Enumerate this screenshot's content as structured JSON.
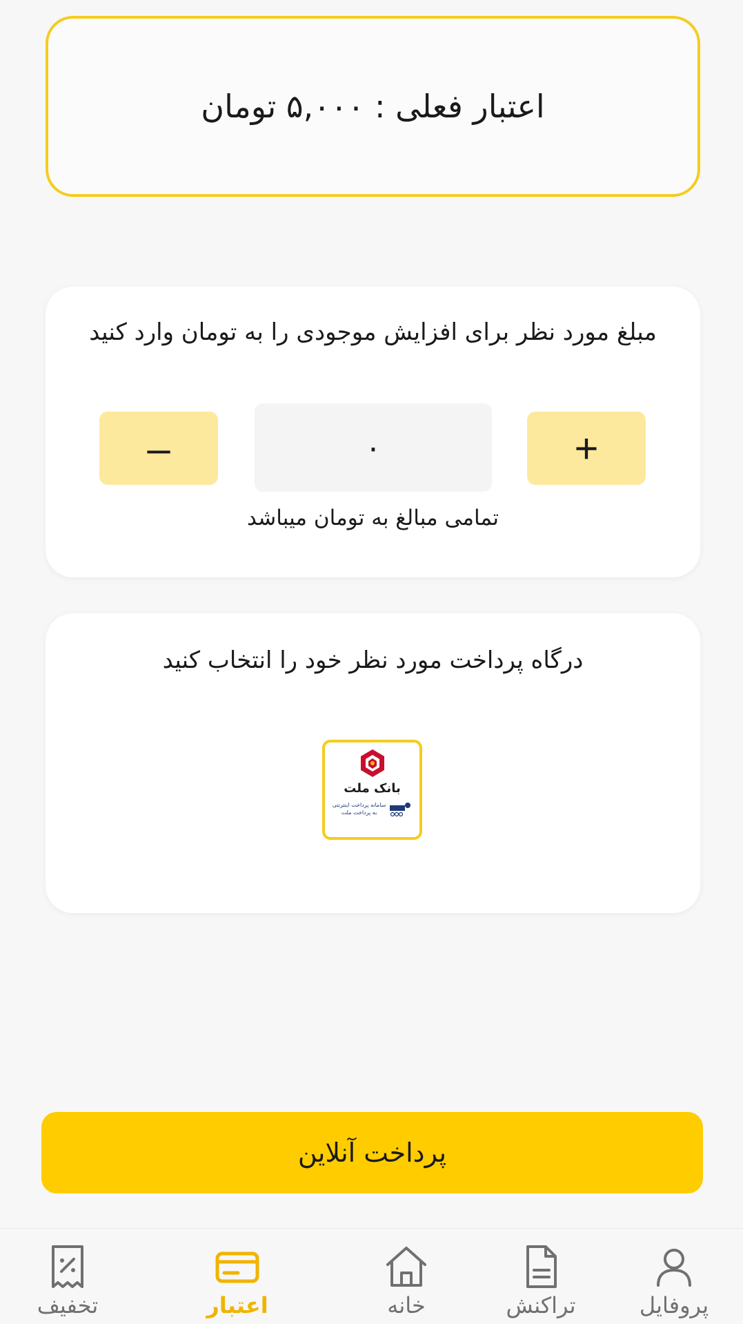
{
  "balance": {
    "text": "اعتبار فعلی : ۵,۰۰۰ تومان"
  },
  "amount_section": {
    "title": "مبلغ مورد نظر برای افزایش موجودی را به تومان وارد کنید",
    "plus_label": "+",
    "minus_label": "–",
    "amount_value": "۰",
    "hint": "تمامی مبالغ به تومان میباشد"
  },
  "gateway_section": {
    "title": "درگاه پرداخت مورد نظر خود را انتخاب کنید",
    "gateway": {
      "name": "بانک ملت",
      "subtitle_line1": "سامانه پرداخت اینترنتی",
      "subtitle_line2": "به پرداخت ملت"
    }
  },
  "pay_button": {
    "label": "پرداخت آنلاین"
  },
  "colors": {
    "accent": "#ffcc00",
    "accent_border": "#f5cc1e",
    "stepper_bg": "#fde99e",
    "active_nav": "#f0b400",
    "inactive_nav": "#707070"
  },
  "nav": {
    "items": [
      {
        "label": "پروفایل",
        "icon": "user-icon",
        "active": false
      },
      {
        "label": "تراکنش",
        "icon": "document-icon",
        "active": false
      },
      {
        "label": "خانه",
        "icon": "home-icon",
        "active": false
      },
      {
        "label": "اعتبار",
        "icon": "credit-card-icon",
        "active": true
      },
      {
        "label": "تخفیف",
        "icon": "discount-receipt-icon",
        "active": false
      }
    ]
  }
}
